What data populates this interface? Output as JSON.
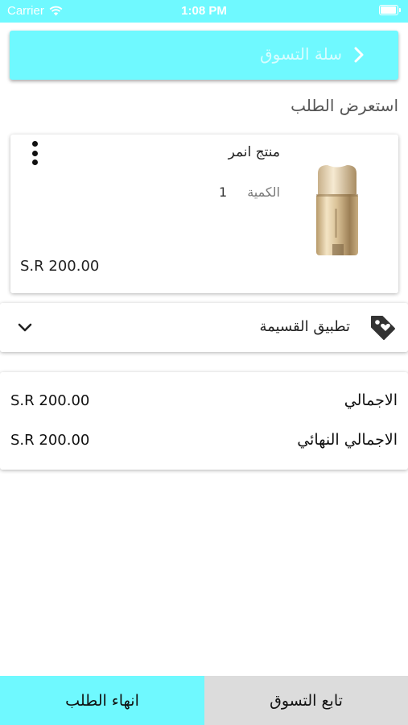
{
  "status_bar": {
    "carrier": "Carrier",
    "time": "1:08 PM"
  },
  "header": {
    "title": "سلة التسوق",
    "accent_color": "#6ff9ff"
  },
  "order": {
    "section_label": "استعرض الطلب",
    "items": [
      {
        "name": "منتج انمر",
        "quantity_label": "الكمية",
        "quantity": "1",
        "price": "S.R 200.00"
      }
    ]
  },
  "coupon": {
    "label": "تطبيق القسيمة"
  },
  "totals": {
    "subtotal_label": "الاجمالي",
    "subtotal_value": "S.R 200.00",
    "total_label": "الاجمالي النهائي",
    "total_value": "S.R 200.00"
  },
  "footer": {
    "continue_label": "تابع التسوق",
    "finish_label": "انهاء الطلب"
  },
  "icons": [
    "wifi-icon",
    "battery-icon",
    "chevron-right-icon",
    "more-vertical-icon",
    "product-image",
    "chevron-down-icon",
    "tag-icon"
  ]
}
